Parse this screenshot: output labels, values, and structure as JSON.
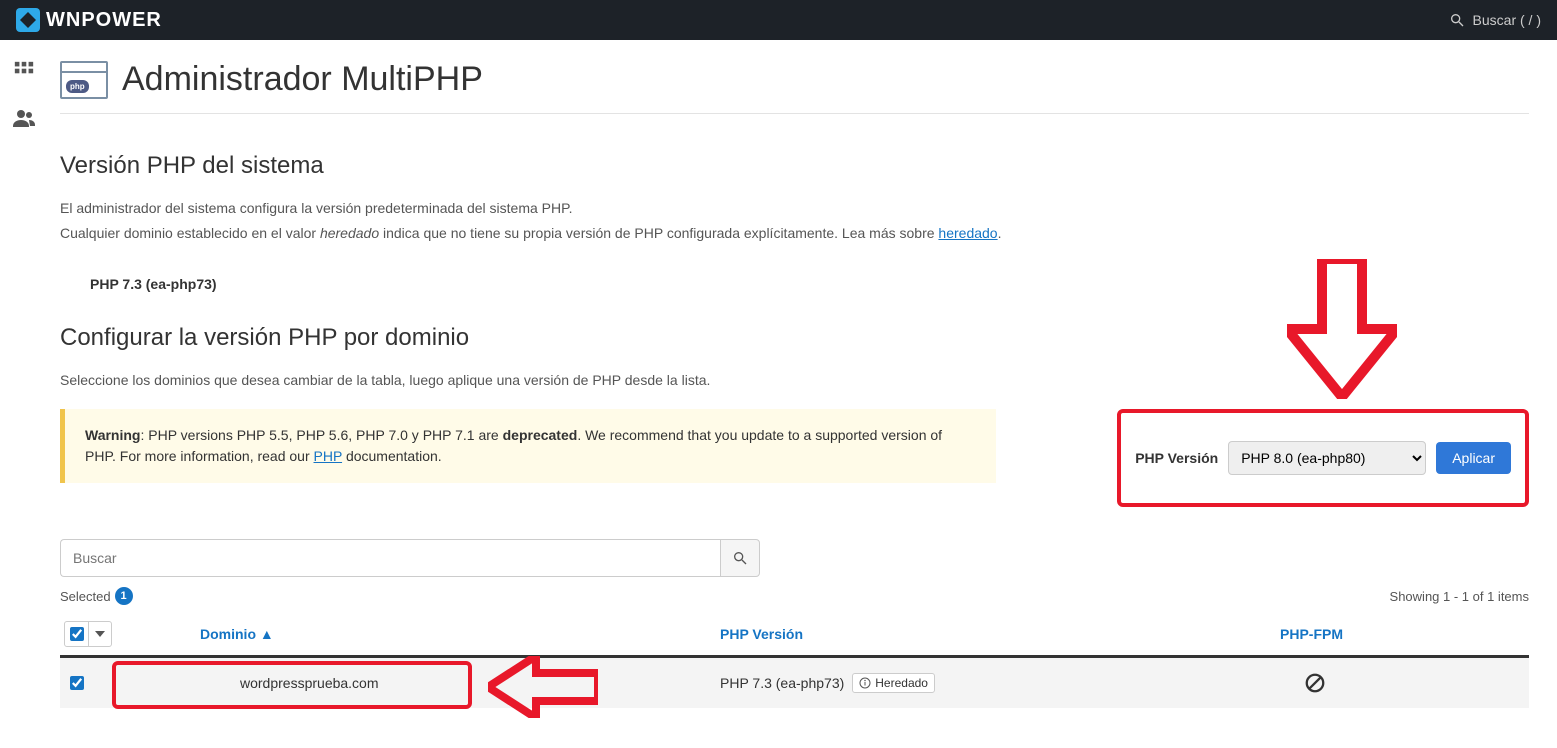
{
  "brand": "WNPOWER",
  "search_hint": "Buscar ( / )",
  "page": {
    "title": "Administrador MultiPHP",
    "php_badge": "php"
  },
  "system": {
    "heading": "Versión PHP del sistema",
    "desc1": "El administrador del sistema configura la versión predeterminada del sistema PHP.",
    "desc2_a": "Cualquier dominio establecido en el valor ",
    "desc2_em": "heredado",
    "desc2_b": " indica que no tiene su propia versión de PHP configurada explícitamente. Lea más sobre ",
    "desc2_link": "heredado",
    "desc2_c": ".",
    "version": "PHP 7.3 (ea-php73)"
  },
  "config": {
    "heading": "Configurar la versión PHP por dominio",
    "tip": "Seleccione los dominios que desea cambiar de la tabla, luego aplique una versión de PHP desde la lista.",
    "warning_strong1": "Warning",
    "warning_mid": ": PHP versions PHP 5.5, PHP 5.6, PHP 7.0 y PHP 7.1 are ",
    "warning_strong2": "deprecated",
    "warning_tail": ". We recommend that you update to a supported version of PHP. For more information, read our ",
    "warning_link": "PHP",
    "warning_end": " documentation.",
    "phpver_label": "PHP Versión",
    "phpver_selected": "PHP 8.0 (ea-php80)",
    "apply": "Aplicar"
  },
  "toolbar": {
    "search_placeholder": "Buscar",
    "selected_label": "Selected",
    "selected_count": "1",
    "showing_a": "Showing ",
    "showing_b": "1 - 1 of 1 items"
  },
  "table": {
    "col_domain": "Dominio ▲",
    "col_version": "PHP Versión",
    "col_fpm": "PHP-FPM",
    "rows": [
      {
        "domain": "wordpressprueba.com",
        "version": "PHP 7.3 (ea-php73)",
        "inherited": "Heredado"
      }
    ]
  }
}
